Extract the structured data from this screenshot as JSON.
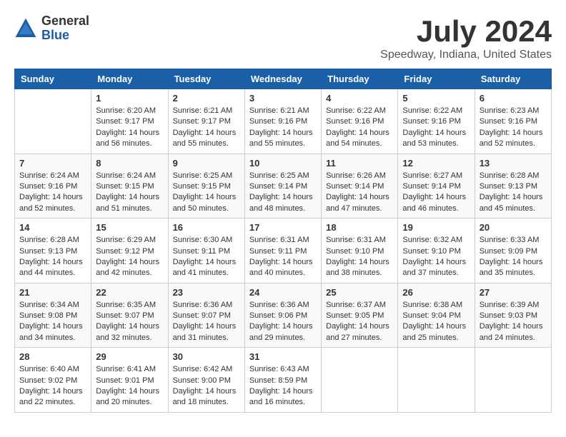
{
  "logo": {
    "general": "General",
    "blue": "Blue"
  },
  "title": "July 2024",
  "subtitle": "Speedway, Indiana, United States",
  "days": [
    "Sunday",
    "Monday",
    "Tuesday",
    "Wednesday",
    "Thursday",
    "Friday",
    "Saturday"
  ],
  "weeks": [
    [
      {
        "date": "",
        "sunrise": "",
        "sunset": "",
        "daylight": ""
      },
      {
        "date": "1",
        "sunrise": "Sunrise: 6:20 AM",
        "sunset": "Sunset: 9:17 PM",
        "daylight": "Daylight: 14 hours and 56 minutes."
      },
      {
        "date": "2",
        "sunrise": "Sunrise: 6:21 AM",
        "sunset": "Sunset: 9:17 PM",
        "daylight": "Daylight: 14 hours and 55 minutes."
      },
      {
        "date": "3",
        "sunrise": "Sunrise: 6:21 AM",
        "sunset": "Sunset: 9:16 PM",
        "daylight": "Daylight: 14 hours and 55 minutes."
      },
      {
        "date": "4",
        "sunrise": "Sunrise: 6:22 AM",
        "sunset": "Sunset: 9:16 PM",
        "daylight": "Daylight: 14 hours and 54 minutes."
      },
      {
        "date": "5",
        "sunrise": "Sunrise: 6:22 AM",
        "sunset": "Sunset: 9:16 PM",
        "daylight": "Daylight: 14 hours and 53 minutes."
      },
      {
        "date": "6",
        "sunrise": "Sunrise: 6:23 AM",
        "sunset": "Sunset: 9:16 PM",
        "daylight": "Daylight: 14 hours and 52 minutes."
      }
    ],
    [
      {
        "date": "7",
        "sunrise": "Sunrise: 6:24 AM",
        "sunset": "Sunset: 9:16 PM",
        "daylight": "Daylight: 14 hours and 52 minutes."
      },
      {
        "date": "8",
        "sunrise": "Sunrise: 6:24 AM",
        "sunset": "Sunset: 9:15 PM",
        "daylight": "Daylight: 14 hours and 51 minutes."
      },
      {
        "date": "9",
        "sunrise": "Sunrise: 6:25 AM",
        "sunset": "Sunset: 9:15 PM",
        "daylight": "Daylight: 14 hours and 50 minutes."
      },
      {
        "date": "10",
        "sunrise": "Sunrise: 6:25 AM",
        "sunset": "Sunset: 9:14 PM",
        "daylight": "Daylight: 14 hours and 48 minutes."
      },
      {
        "date": "11",
        "sunrise": "Sunrise: 6:26 AM",
        "sunset": "Sunset: 9:14 PM",
        "daylight": "Daylight: 14 hours and 47 minutes."
      },
      {
        "date": "12",
        "sunrise": "Sunrise: 6:27 AM",
        "sunset": "Sunset: 9:14 PM",
        "daylight": "Daylight: 14 hours and 46 minutes."
      },
      {
        "date": "13",
        "sunrise": "Sunrise: 6:28 AM",
        "sunset": "Sunset: 9:13 PM",
        "daylight": "Daylight: 14 hours and 45 minutes."
      }
    ],
    [
      {
        "date": "14",
        "sunrise": "Sunrise: 6:28 AM",
        "sunset": "Sunset: 9:13 PM",
        "daylight": "Daylight: 14 hours and 44 minutes."
      },
      {
        "date": "15",
        "sunrise": "Sunrise: 6:29 AM",
        "sunset": "Sunset: 9:12 PM",
        "daylight": "Daylight: 14 hours and 42 minutes."
      },
      {
        "date": "16",
        "sunrise": "Sunrise: 6:30 AM",
        "sunset": "Sunset: 9:11 PM",
        "daylight": "Daylight: 14 hours and 41 minutes."
      },
      {
        "date": "17",
        "sunrise": "Sunrise: 6:31 AM",
        "sunset": "Sunset: 9:11 PM",
        "daylight": "Daylight: 14 hours and 40 minutes."
      },
      {
        "date": "18",
        "sunrise": "Sunrise: 6:31 AM",
        "sunset": "Sunset: 9:10 PM",
        "daylight": "Daylight: 14 hours and 38 minutes."
      },
      {
        "date": "19",
        "sunrise": "Sunrise: 6:32 AM",
        "sunset": "Sunset: 9:10 PM",
        "daylight": "Daylight: 14 hours and 37 minutes."
      },
      {
        "date": "20",
        "sunrise": "Sunrise: 6:33 AM",
        "sunset": "Sunset: 9:09 PM",
        "daylight": "Daylight: 14 hours and 35 minutes."
      }
    ],
    [
      {
        "date": "21",
        "sunrise": "Sunrise: 6:34 AM",
        "sunset": "Sunset: 9:08 PM",
        "daylight": "Daylight: 14 hours and 34 minutes."
      },
      {
        "date": "22",
        "sunrise": "Sunrise: 6:35 AM",
        "sunset": "Sunset: 9:07 PM",
        "daylight": "Daylight: 14 hours and 32 minutes."
      },
      {
        "date": "23",
        "sunrise": "Sunrise: 6:36 AM",
        "sunset": "Sunset: 9:07 PM",
        "daylight": "Daylight: 14 hours and 31 minutes."
      },
      {
        "date": "24",
        "sunrise": "Sunrise: 6:36 AM",
        "sunset": "Sunset: 9:06 PM",
        "daylight": "Daylight: 14 hours and 29 minutes."
      },
      {
        "date": "25",
        "sunrise": "Sunrise: 6:37 AM",
        "sunset": "Sunset: 9:05 PM",
        "daylight": "Daylight: 14 hours and 27 minutes."
      },
      {
        "date": "26",
        "sunrise": "Sunrise: 6:38 AM",
        "sunset": "Sunset: 9:04 PM",
        "daylight": "Daylight: 14 hours and 25 minutes."
      },
      {
        "date": "27",
        "sunrise": "Sunrise: 6:39 AM",
        "sunset": "Sunset: 9:03 PM",
        "daylight": "Daylight: 14 hours and 24 minutes."
      }
    ],
    [
      {
        "date": "28",
        "sunrise": "Sunrise: 6:40 AM",
        "sunset": "Sunset: 9:02 PM",
        "daylight": "Daylight: 14 hours and 22 minutes."
      },
      {
        "date": "29",
        "sunrise": "Sunrise: 6:41 AM",
        "sunset": "Sunset: 9:01 PM",
        "daylight": "Daylight: 14 hours and 20 minutes."
      },
      {
        "date": "30",
        "sunrise": "Sunrise: 6:42 AM",
        "sunset": "Sunset: 9:00 PM",
        "daylight": "Daylight: 14 hours and 18 minutes."
      },
      {
        "date": "31",
        "sunrise": "Sunrise: 6:43 AM",
        "sunset": "Sunset: 8:59 PM",
        "daylight": "Daylight: 14 hours and 16 minutes."
      },
      {
        "date": "",
        "sunrise": "",
        "sunset": "",
        "daylight": ""
      },
      {
        "date": "",
        "sunrise": "",
        "sunset": "",
        "daylight": ""
      },
      {
        "date": "",
        "sunrise": "",
        "sunset": "",
        "daylight": ""
      }
    ]
  ]
}
